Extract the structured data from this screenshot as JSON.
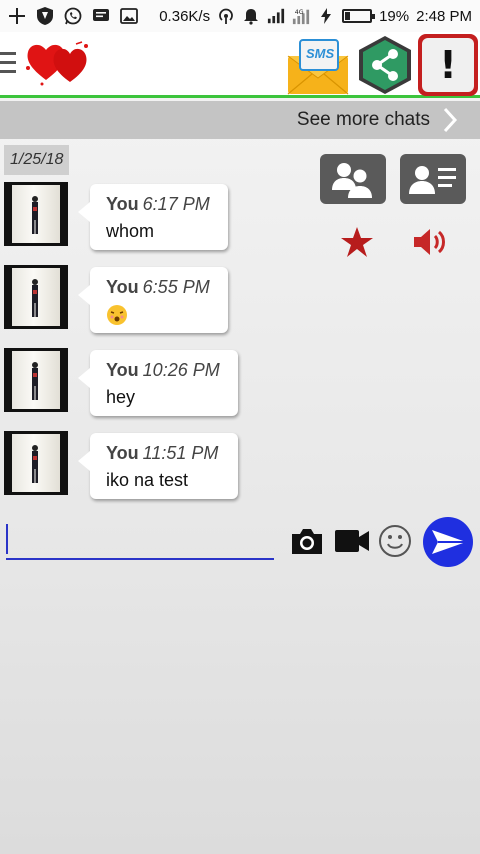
{
  "status_bar": {
    "net_speed": "0.36K/s",
    "battery": "19%",
    "battery_level": 0.19,
    "time": "2:48 PM",
    "icons": [
      "plus-icon",
      "shield-icon",
      "whatsapp-icon",
      "message-icon",
      "image-icon",
      "hotspot-icon",
      "alarm-icon",
      "signal-icon",
      "signal-4g-icon",
      "charging-icon",
      "battery-icon"
    ]
  },
  "app_bar": {
    "menu_icon": "hamburger-icon",
    "logo": "hearts-logo",
    "sms_label": "SMS",
    "share_icon": "share-icon",
    "alert_label": "!"
  },
  "see_more": {
    "label": "See more chats"
  },
  "date_chip": "1/25/18",
  "actions": {
    "group_icon": "group-users-icon",
    "contact_icon": "contact-card-icon",
    "star_icon": "star-icon",
    "speaker_icon": "speaker-icon",
    "accent": "#b71c1c"
  },
  "messages": [
    {
      "sender": "You",
      "time": "6:17 PM",
      "text": "whom"
    },
    {
      "sender": "You",
      "time": "6:55 PM",
      "text": "",
      "emoji": "kiss-face-emoji"
    },
    {
      "sender": "You",
      "time": "10:26 PM",
      "text": "hey"
    },
    {
      "sender": "You",
      "time": "11:51 PM",
      "text": "iko na test"
    }
  ],
  "composer": {
    "value": "",
    "placeholder": "",
    "camera_icon": "camera-icon",
    "video_icon": "video-camera-icon",
    "emoji_icon": "smiley-icon",
    "send_icon": "send-icon",
    "send_color": "#1f2fe0"
  }
}
